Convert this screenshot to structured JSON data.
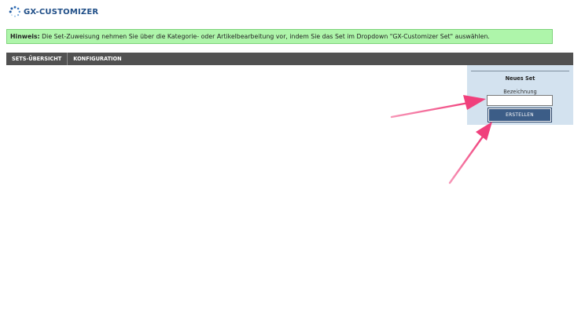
{
  "app": {
    "title": "GX-CUSTOMIZER",
    "logo_icon": "dotted-ring-icon"
  },
  "notice": {
    "label": "Hinweis:",
    "text": " Die Set-Zuweisung nehmen Sie über die Kategorie- oder Artikelbearbeitung vor, indem Sie das Set im Dropdown \"GX-Customizer Set\" auswählen.",
    "background_color": "#aef5aa"
  },
  "tabs": [
    {
      "label": "SETS-ÜBERSICHT"
    },
    {
      "label": "KONFIGURATION"
    }
  ],
  "new_set_panel": {
    "title": "Neues Set",
    "field_label": "Bezeichnung",
    "input_value": "",
    "button_label": "ERSTELLEN"
  },
  "annotations": {
    "arrow_color": "#f0407c",
    "arrow_icons": [
      "arrow-to-input-icon",
      "arrow-to-button-icon"
    ]
  }
}
